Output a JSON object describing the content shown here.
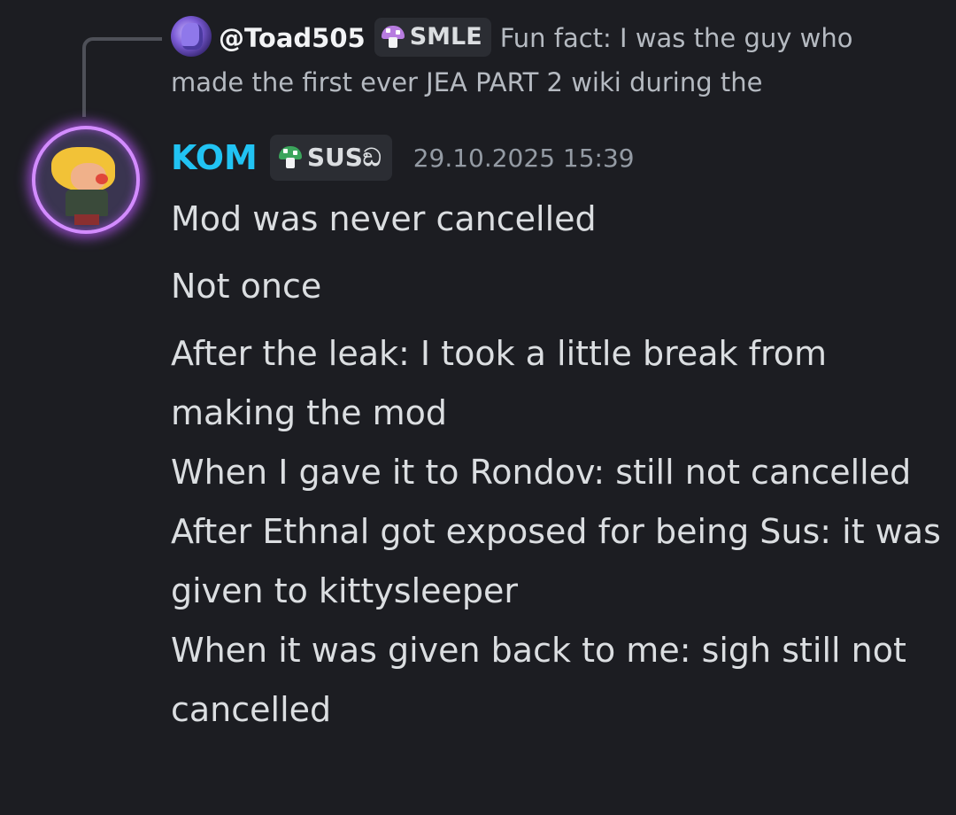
{
  "reply": {
    "username": "@Toad505",
    "tag_label": "SMLE",
    "tag_icon": "purple-mushroom-icon",
    "tag_color": "#b77ce0",
    "preview_text": "Fun fact: I was the guy who made the first ever JEA PART 2 wiki during the"
  },
  "message": {
    "username": "KOM",
    "username_color": "#21c3f3",
    "tag_label": "SUSඞ",
    "tag_icon": "green-mushroom-icon",
    "tag_color": "#3ba55c",
    "timestamp": "29.10.2025 15:39",
    "lines": [
      "Mod was never cancelled",
      "Not once",
      "After the leak: I took a little break from making the mod",
      "When I gave it to Rondov: still not cancelled",
      "After Ethnal got exposed for being Sus: it was given to kittysleeper",
      "When it was given back to me: sigh still not cancelled"
    ]
  }
}
